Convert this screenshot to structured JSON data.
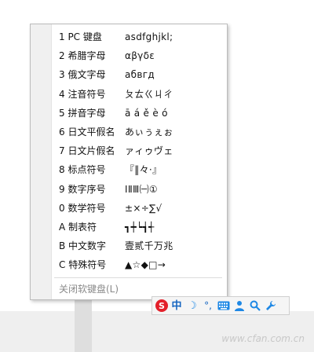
{
  "menu": {
    "items": [
      {
        "label": "1 PC 键盘",
        "sample": "asdfghjkl;"
      },
      {
        "label": "2 希腊字母",
        "sample": "αβγδε"
      },
      {
        "label": "3 俄文字母",
        "sample": "абвгд"
      },
      {
        "label": "4 注音符号",
        "sample": "ㄆㄊㄍㄐㄔ"
      },
      {
        "label": "5 拼音字母",
        "sample": "ā á ě è ó"
      },
      {
        "label": "6 日文平假名",
        "sample": "あぃぅぇぉ"
      },
      {
        "label": "7 日文片假名",
        "sample": "ァィゥヴェ"
      },
      {
        "label": "8 标点符号",
        "sample": "『‖々·』"
      },
      {
        "label": "9 数字序号",
        "sample": "ⅠⅡⅢ㈠①"
      },
      {
        "label": "0 数学符号",
        "sample": "±×÷∑√"
      },
      {
        "label": "A 制表符",
        "sample": "┓┿┕┪┽"
      },
      {
        "label": "B 中文数字",
        "sample": "壹贰千万兆"
      },
      {
        "label": "C 特殊符号",
        "sample": "▲☆◆□→"
      }
    ],
    "close_label": "关闭软键盘(L)"
  },
  "toolbar": {
    "logo": "S",
    "lang": "中",
    "icons": [
      "sogou-logo-icon",
      "chinese-mode-icon",
      "moon-icon",
      "punctuation-icon",
      "keyboard-icon",
      "user-icon",
      "search-icon",
      "wrench-icon"
    ]
  },
  "watermark": "www.cfan.com.cn"
}
